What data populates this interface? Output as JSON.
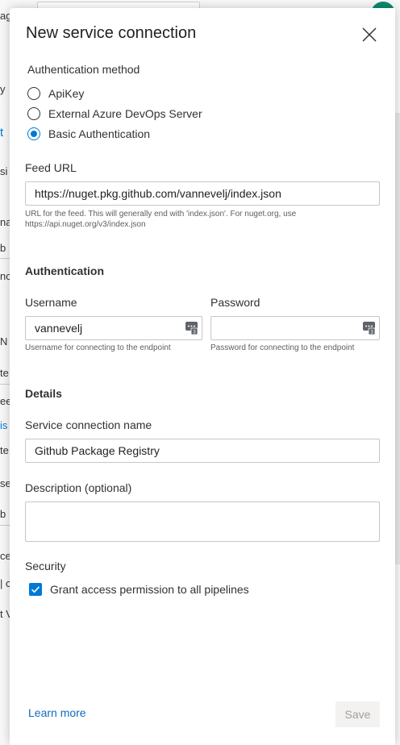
{
  "background": {
    "fragments": [
      "ag",
      "y",
      "t",
      "si",
      "na",
      "b",
      "nc",
      "N",
      "te",
      "ee",
      "is",
      "te",
      "se",
      "b",
      "ce",
      "| c",
      "t V"
    ]
  },
  "dialog": {
    "title": "New service connection",
    "auth_method": {
      "label": "Authentication method",
      "options": [
        {
          "label": "ApiKey",
          "selected": false
        },
        {
          "label": "External Azure DevOps Server",
          "selected": false
        },
        {
          "label": "Basic Authentication",
          "selected": true
        }
      ]
    },
    "feed_url": {
      "label": "Feed URL",
      "value": "https://nuget.pkg.github.com/vannevelj/index.json",
      "hint": "URL for the feed. This will generally end with 'index.json'. For nuget.org, use https://api.nuget.org/v3/index.json"
    },
    "authentication": {
      "title": "Authentication",
      "username": {
        "label": "Username",
        "value": "vannevelj",
        "hint": "Username for connecting to the endpoint"
      },
      "password": {
        "label": "Password",
        "value": "",
        "hint": "Password for connecting to the endpoint"
      }
    },
    "details": {
      "title": "Details",
      "name": {
        "label": "Service connection name",
        "value": "Github Package Registry"
      },
      "description": {
        "label": "Description (optional)",
        "value": ""
      }
    },
    "security": {
      "label": "Security",
      "grant_access": {
        "label": "Grant access permission to all pipelines",
        "checked": true
      }
    },
    "footer": {
      "learn_more": "Learn more",
      "save": "Save"
    }
  }
}
